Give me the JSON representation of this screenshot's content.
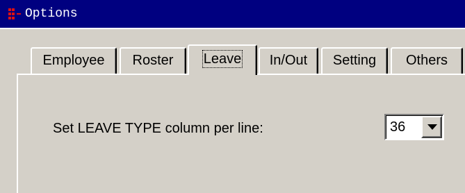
{
  "window": {
    "title": "Options",
    "app_icon": "app-logo-icon"
  },
  "tabs": [
    {
      "label": "Employee",
      "active": false
    },
    {
      "label": "Roster",
      "active": false
    },
    {
      "label": "Leave",
      "active": true
    },
    {
      "label": "In/Out",
      "active": false
    },
    {
      "label": "Setting",
      "active": false
    },
    {
      "label": "Others",
      "active": false
    }
  ],
  "leave_panel": {
    "column_label": "Set LEAVE TYPE column per line:",
    "column_value": "36",
    "dropdown_icon": "chevron-down-icon"
  },
  "colors": {
    "titlebar": "#000080",
    "face": "#d4d0c8",
    "icon_red": "#e01010"
  }
}
